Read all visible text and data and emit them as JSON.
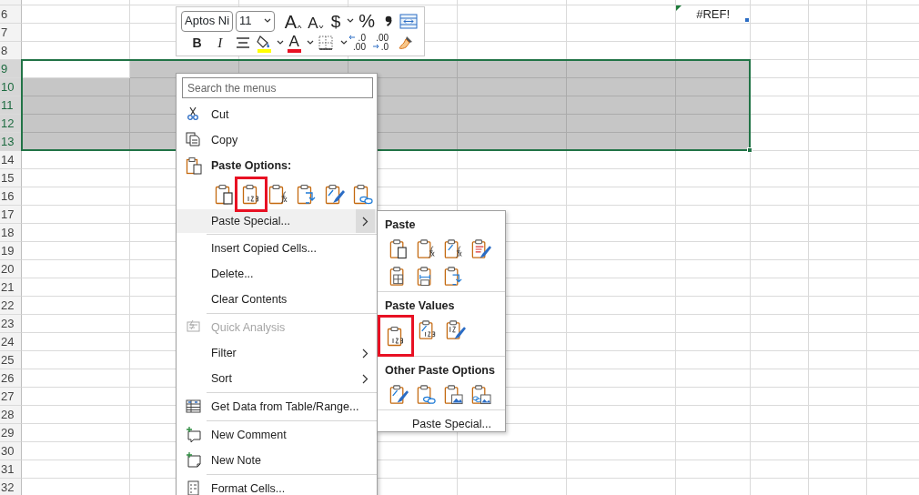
{
  "toolbar": {
    "font": {
      "value": "Aptos Ni"
    },
    "size": {
      "value": "11"
    },
    "lines": [
      {
        "buttons": [
          {
            "kind": "grow-font",
            "label": "A",
            "caret": false
          },
          {
            "kind": "shrink-font",
            "label": "A",
            "caret": false
          },
          {
            "kind": "currency",
            "label": "$",
            "caret": true
          },
          {
            "kind": "percent",
            "label": "%",
            "caret": false
          },
          {
            "kind": "comma",
            "caret": false
          },
          {
            "kind": "wrap",
            "caret": false
          }
        ]
      },
      {
        "buttons": [
          {
            "kind": "bold",
            "label": "B",
            "caret": false
          },
          {
            "kind": "italic",
            "label": "I",
            "caret": false
          },
          {
            "kind": "align",
            "caret": false
          },
          {
            "kind": "fill-color",
            "color": "#ffff00",
            "caret": true
          },
          {
            "kind": "font-color",
            "label": "A",
            "color": "#e81123",
            "caret": true
          },
          {
            "kind": "borders",
            "caret": true
          },
          {
            "kind": "increase-decimal",
            "label": ".0\n.00",
            "caret": false
          },
          {
            "kind": "decrease-decimal",
            "label": ".00\n.0",
            "caret": false
          },
          {
            "kind": "painter",
            "caret": false
          }
        ]
      }
    ]
  },
  "sheet": {
    "columns": [
      {
        "selected": true
      },
      {
        "selected": true
      },
      {
        "selected": true
      },
      {
        "selected": true
      },
      {
        "selected": true
      },
      {
        "selected": true
      },
      {
        "selected": true
      },
      {
        "selected": false
      },
      {
        "selected": false
      },
      {
        "selected": false
      }
    ],
    "rows": [
      {
        "label": "6",
        "selected": false,
        "cells": [
          null,
          null,
          null,
          null,
          null,
          null,
          {
            "text": "#REF!",
            "error_flag": true,
            "corner_mark": true
          }
        ]
      },
      {
        "label": "7",
        "selected": false
      },
      {
        "label": "8",
        "selected": false
      },
      {
        "label": "9",
        "selected": true
      },
      {
        "label": "10",
        "selected": true
      },
      {
        "label": "11",
        "selected": true
      },
      {
        "label": "12",
        "selected": true
      },
      {
        "label": "13",
        "selected": true
      },
      {
        "label": "14",
        "selected": false
      },
      {
        "label": "15",
        "selected": false
      },
      {
        "label": "16",
        "selected": false
      },
      {
        "label": "17",
        "selected": false
      },
      {
        "label": "18",
        "selected": false
      },
      {
        "label": "19",
        "selected": false
      },
      {
        "label": "20",
        "selected": false
      },
      {
        "label": "21",
        "selected": false
      },
      {
        "label": "22",
        "selected": false
      },
      {
        "label": "23",
        "selected": false
      },
      {
        "label": "24",
        "selected": false
      },
      {
        "label": "25",
        "selected": false
      },
      {
        "label": "26",
        "selected": false
      },
      {
        "label": "27",
        "selected": false
      },
      {
        "label": "28",
        "selected": false
      },
      {
        "label": "29",
        "selected": false
      },
      {
        "label": "30",
        "selected": false
      },
      {
        "label": "31",
        "selected": false
      },
      {
        "label": "32",
        "selected": false
      }
    ]
  },
  "context_menu": {
    "search": {
      "placeholder": "Search the menus"
    },
    "items": [
      {
        "kind": "command",
        "label": "Cut",
        "disabled": false,
        "submenu": false,
        "expanded": false
      },
      {
        "kind": "command",
        "label": "Copy",
        "disabled": false,
        "submenu": false,
        "expanded": false
      },
      {
        "kind": "header",
        "label": "Paste Options:"
      },
      {
        "kind": "paste-row",
        "options": [
          {
            "kind": "paste",
            "selected": false
          },
          {
            "kind": "values",
            "selected": true
          },
          {
            "kind": "formulas",
            "selected": false
          },
          {
            "kind": "transpose",
            "selected": false
          },
          {
            "kind": "formatting",
            "selected": false
          },
          {
            "kind": "link",
            "selected": false
          }
        ]
      },
      {
        "kind": "command",
        "label": "Paste Special...",
        "disabled": false,
        "submenu": true,
        "expanded": true
      },
      {
        "kind": "separator"
      },
      {
        "kind": "command",
        "label": "Insert Copied Cells...",
        "disabled": false,
        "submenu": false,
        "expanded": false
      },
      {
        "kind": "command",
        "label": "Delete...",
        "disabled": false,
        "submenu": false,
        "expanded": false
      },
      {
        "kind": "command",
        "label": "Clear Contents",
        "disabled": false,
        "submenu": false,
        "expanded": false
      },
      {
        "kind": "separator"
      },
      {
        "kind": "command",
        "label": "Quick Analysis",
        "disabled": true,
        "submenu": false,
        "expanded": false
      },
      {
        "kind": "command",
        "label": "Filter",
        "disabled": false,
        "submenu": true,
        "expanded": false
      },
      {
        "kind": "command",
        "label": "Sort",
        "disabled": false,
        "submenu": true,
        "expanded": false
      },
      {
        "kind": "separator"
      },
      {
        "kind": "command",
        "label": "Get Data from Table/Range...",
        "disabled": false,
        "submenu": false,
        "expanded": false
      },
      {
        "kind": "separator"
      },
      {
        "kind": "command",
        "label": "New Comment",
        "disabled": false,
        "submenu": false,
        "expanded": false
      },
      {
        "kind": "command",
        "label": "New Note",
        "disabled": false,
        "submenu": false,
        "expanded": false
      },
      {
        "kind": "separator"
      },
      {
        "kind": "command",
        "label": "Format Cells...",
        "disabled": false,
        "submenu": false,
        "expanded": false
      }
    ]
  },
  "submenu": {
    "sections": [
      {
        "title": "Paste",
        "options": [
          {
            "kind": "paste",
            "selected": false
          },
          {
            "kind": "formulas",
            "selected": false
          },
          {
            "kind": "formulas-number-format",
            "selected": false
          },
          {
            "kind": "keep-source-formatting",
            "selected": false
          },
          {
            "kind": "no-borders",
            "selected": false
          },
          {
            "kind": "column-widths",
            "selected": false
          },
          {
            "kind": "transpose",
            "selected": false
          }
        ]
      },
      {
        "title": "Paste Values",
        "options": [
          {
            "kind": "values",
            "selected": true
          },
          {
            "kind": "values-number-format",
            "selected": false
          },
          {
            "kind": "values-source-formatting",
            "selected": false
          }
        ]
      },
      {
        "title": "Other Paste Options",
        "options": [
          {
            "kind": "formatting",
            "selected": false
          },
          {
            "kind": "link",
            "selected": false
          },
          {
            "kind": "picture",
            "selected": false
          },
          {
            "kind": "linked-picture",
            "selected": false
          }
        ]
      }
    ],
    "footer": "Paste Special..."
  }
}
